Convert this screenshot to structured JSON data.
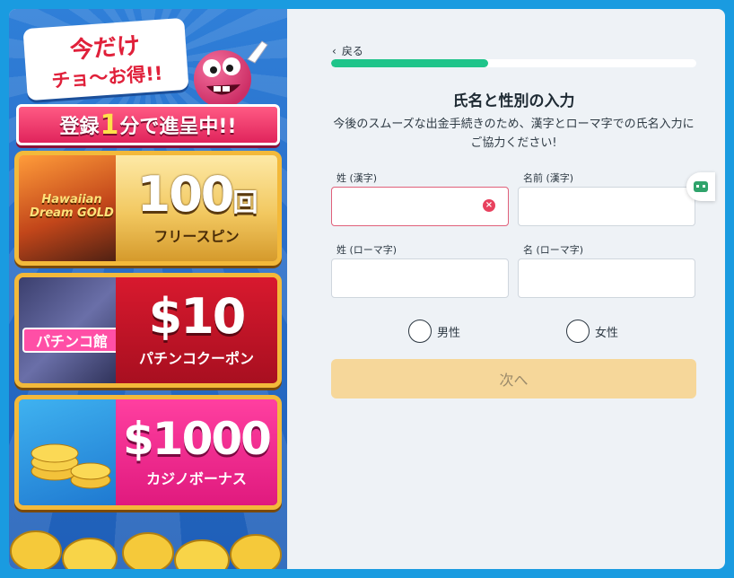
{
  "promo": {
    "limited_line1": "今だけ",
    "limited_line2": "チョ〜お得!!",
    "headline_pre": "登録",
    "headline_big": "1",
    "headline_post": "分で進呈中!!",
    "cards": [
      {
        "game": "Hawaiian Dream GOLD",
        "amount": "100",
        "amount_suffix": "回",
        "label": "フリースピン"
      },
      {
        "game": "パチンコ館",
        "amount": "$10",
        "label": "パチンコクーポン"
      },
      {
        "amount": "$1000",
        "label": "カジノボーナス"
      }
    ]
  },
  "form": {
    "back_label": "戻る",
    "progress": 0.43,
    "progress_color": "#1fc48a",
    "title": "氏名と性別の入力",
    "description": "今後のスムーズな出金手続きのため、漢字とローマ字での氏名入力にご協力ください!",
    "fields": {
      "last_kanji_label": "姓 (漢字)",
      "first_kanji_label": "名前 (漢字)",
      "last_roman_label": "姓 (ローマ字)",
      "first_roman_label": "名 (ローマ字)",
      "last_kanji_value": "",
      "first_kanji_value": "",
      "last_roman_value": "",
      "first_roman_value": ""
    },
    "gender": {
      "male": "男性",
      "female": "女性"
    },
    "next_label": "次へ"
  }
}
